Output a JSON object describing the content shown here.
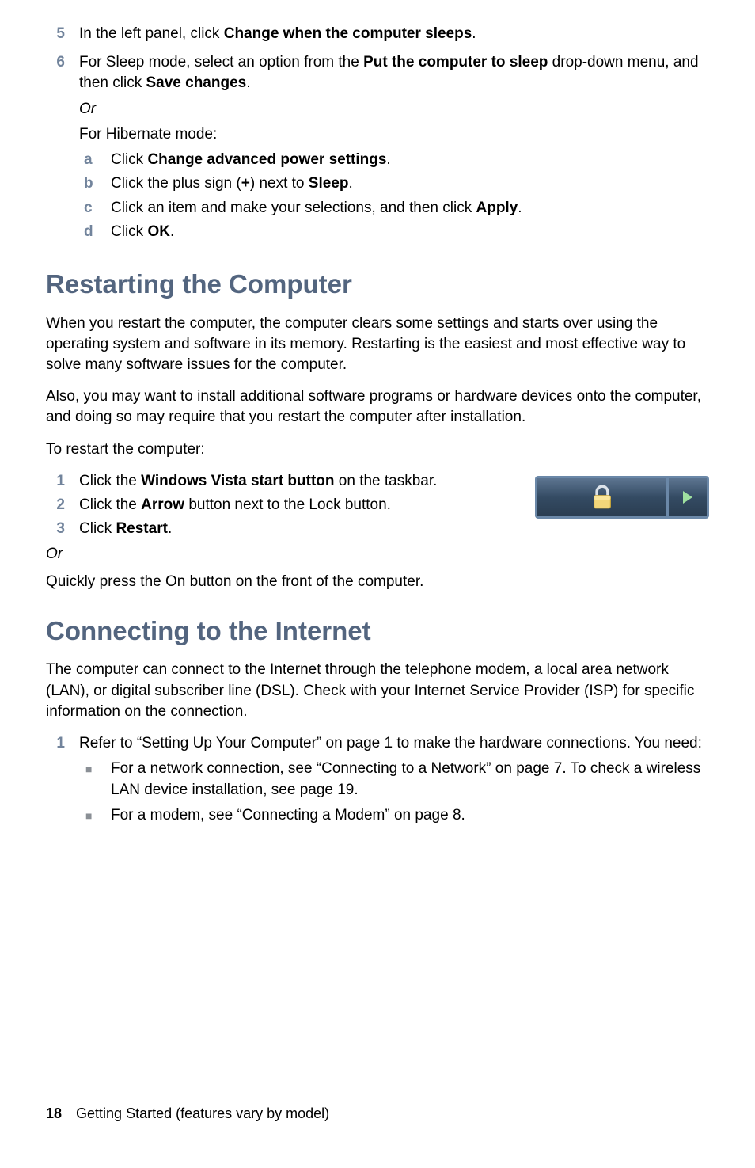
{
  "cont_step5": {
    "num": "5",
    "text_a": "In the left panel, click ",
    "bold_a": "Change when the computer sleeps",
    "text_b": "."
  },
  "cont_step6": {
    "num": "6",
    "line1_a": "For Sleep mode, select an option from the ",
    "line1_bold": "Put the computer to sleep",
    "line1_b": " drop-down menu, and then click ",
    "line1_bold2": "Save changes",
    "line1_c": ".",
    "or": "Or",
    "line2": "For Hibernate mode:",
    "sub_a": {
      "m": "a",
      "t1": "Click ",
      "b": "Change advanced power settings",
      "t2": "."
    },
    "sub_b": {
      "m": "b",
      "t1": "Click the plus sign (",
      "b": "+",
      "t2": ") next to ",
      "b2": "Sleep",
      "t3": "."
    },
    "sub_c": {
      "m": "c",
      "t1": "Click an item and make your selections, and then click ",
      "b": "Apply",
      "t2": "."
    },
    "sub_d": {
      "m": "d",
      "t1": "Click ",
      "b": "OK",
      "t2": "."
    }
  },
  "restarting": {
    "heading": "Restarting the Computer",
    "p1": "When you restart the computer, the computer clears some settings and starts over using the operating system and software in its memory. Restarting is the easiest and most effective way to solve many software issues for the computer.",
    "p2": "Also, you may want to install additional software programs or hardware devices onto the computer, and doing so may require that you restart the computer after installation.",
    "p3": "To restart the computer:",
    "s1": {
      "n": "1",
      "t1": "Click the ",
      "b": "Windows Vista start button",
      "t2": " on the taskbar."
    },
    "s2": {
      "n": "2",
      "t1": "Click the ",
      "b": "Arrow",
      "t2": " button next to the Lock button."
    },
    "s3": {
      "n": "3",
      "t1": "Click ",
      "b": "Restart",
      "t2": "."
    },
    "or": "Or",
    "p4": "Quickly press the On button on the front of the computer."
  },
  "connecting": {
    "heading": "Connecting to the Internet",
    "p1": "The computer can connect to the Internet through the telephone modem, a local area network (LAN), or digital subscriber line (DSL). Check with your Internet Service Provider (ISP) for specific information on the connection.",
    "s1": {
      "n": "1",
      "t": "Refer to “Setting Up Your Computer” on page 1 to make the hardware connections. You need:"
    },
    "b1": "For a network connection, see “Connecting to a Network” on page 7. To check a wireless LAN device installation, see page 19.",
    "b2": "For a modem, see “Connecting a Modem” on page 8."
  },
  "footer": {
    "page": "18",
    "label": "Getting Started (features vary by model)"
  }
}
